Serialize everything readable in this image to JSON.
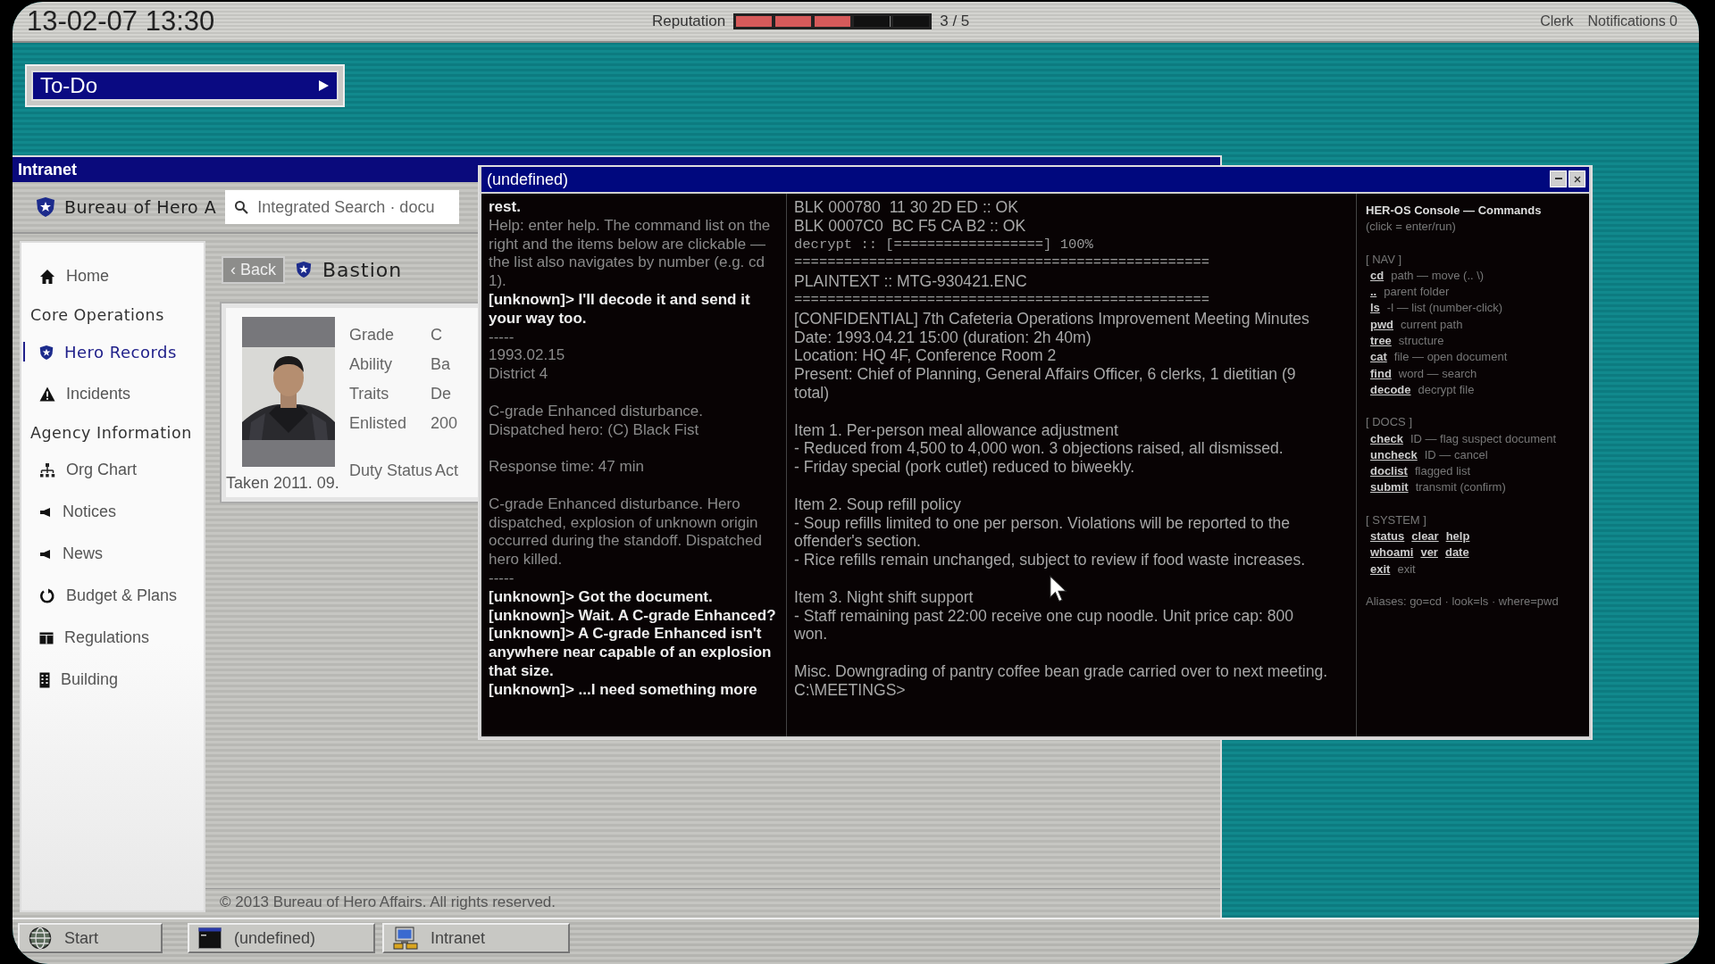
{
  "top_bar": {
    "date_time": "13-02-07 13:30",
    "reputation": {
      "label": "Reputation",
      "level": 0.6,
      "reading": "3 / 5"
    },
    "role": "Clerk",
    "notifications": "Notifications 0"
  },
  "todo": {
    "label": "To-Do"
  },
  "intranet": {
    "title": "Intranet",
    "org_name": "Bureau of Hero A",
    "search": {
      "placeholder": "Integrated Search · docu"
    },
    "sidebar": {
      "items": [
        {
          "kind": "link",
          "label": "Home",
          "selected": false
        },
        {
          "kind": "header",
          "label": "Core Operations"
        },
        {
          "kind": "link",
          "label": "Hero Records",
          "selected": true
        },
        {
          "kind": "link",
          "label": "Incidents",
          "selected": false
        },
        {
          "kind": "header",
          "label": "Agency Information"
        },
        {
          "kind": "link",
          "label": "Org Chart",
          "selected": false
        },
        {
          "kind": "link",
          "label": "Notices",
          "selected": false
        },
        {
          "kind": "link",
          "label": "News",
          "selected": false
        },
        {
          "kind": "link",
          "label": "Budget & Plans",
          "selected": false
        },
        {
          "kind": "link",
          "label": "Regulations",
          "selected": false
        },
        {
          "kind": "link",
          "label": "Building",
          "selected": false
        }
      ]
    },
    "back": "‹ Back",
    "record_title": "Bastion",
    "photo_caption": "Taken 2011. 09.",
    "fields": [
      {
        "label": "Grade",
        "value": "C"
      },
      {
        "label": "Ability",
        "value": "Ba"
      },
      {
        "label": "Traits",
        "value": "De"
      },
      {
        "label": "Enlisted",
        "value": "200"
      },
      {
        "label": "Duty Status",
        "value": "Act"
      }
    ],
    "footer": "© 2013 Bureau of Hero Affairs. All rights reserved."
  },
  "console": {
    "title": "(undefined)",
    "log": [
      {
        "kind": "bright",
        "text": "rest."
      },
      {
        "kind": "dim",
        "text": "Help: enter help. The command list on the right and the items below are clickable — the list also navigates by number (e.g. cd 1)."
      },
      {
        "kind": "bright",
        "text": "[unknown]> I'll decode it and send it your way too."
      },
      {
        "kind": "dim",
        "text": "-----"
      },
      {
        "kind": "dim",
        "text": "1993.02.15"
      },
      {
        "kind": "dim",
        "text": "District 4"
      },
      {
        "kind": "gap"
      },
      {
        "kind": "dim",
        "text": "C-grade Enhanced disturbance."
      },
      {
        "kind": "dim",
        "text": "Dispatched hero: (C) Black Fist"
      },
      {
        "kind": "gap"
      },
      {
        "kind": "dim",
        "text": "Response time: 47 min"
      },
      {
        "kind": "gap"
      },
      {
        "kind": "dim",
        "text": "C-grade Enhanced disturbance. Hero dispatched, explosion of unknown origin occurred during the standoff. Dispatched hero killed."
      },
      {
        "kind": "dim",
        "text": "-----"
      },
      {
        "kind": "bright",
        "text": "[unknown]> Got the document."
      },
      {
        "kind": "bright",
        "text": "[unknown]> Wait. A C-grade Enhanced?"
      },
      {
        "kind": "bright",
        "text": "[unknown]> A C-grade Enhanced isn't anywhere near capable of an explosion that size."
      },
      {
        "kind": "bright",
        "text": "[unknown]> ...I need something more"
      }
    ],
    "document": [
      {
        "kind": "text",
        "text": "BLK 000780  11 30 2D ED :: OK"
      },
      {
        "kind": "text",
        "text": "BLK 0007C0  BC F5 CA B2 :: OK"
      },
      {
        "kind": "mono",
        "text": "decrypt :: [==================] 100%"
      },
      {
        "kind": "mono",
        "text": "=================================================="
      },
      {
        "kind": "text",
        "text": "PLAINTEXT :: MTG-930421.ENC"
      },
      {
        "kind": "mono",
        "text": "=================================================="
      },
      {
        "kind": "text",
        "text": "[CONFIDENTIAL] 7th Cafeteria Operations Improvement Meeting Minutes"
      },
      {
        "kind": "text",
        "text": "Date: 1993.04.21 15:00 (duration: 2h 40m)"
      },
      {
        "kind": "text",
        "text": "Location: HQ 4F, Conference Room 2"
      },
      {
        "kind": "text",
        "text": "Present: Chief of Planning, General Affairs Officer, 6 clerks, 1 dietitian (9 total)"
      },
      {
        "kind": "gap"
      },
      {
        "kind": "text",
        "text": "Item 1. Per-person meal allowance adjustment"
      },
      {
        "kind": "text",
        "text": "- Reduced from 4,500 to 4,000 won. 3 objections raised, all dismissed."
      },
      {
        "kind": "text",
        "text": "- Friday special (pork cutlet) reduced to biweekly."
      },
      {
        "kind": "gap"
      },
      {
        "kind": "text",
        "text": "Item 2. Soup refill policy"
      },
      {
        "kind": "text",
        "text": "- Soup refills limited to one per person. Violations will be reported to the offender's section."
      },
      {
        "kind": "text",
        "text": "- Rice refills remain unchanged, subject to review if food waste increases."
      },
      {
        "kind": "gap"
      },
      {
        "kind": "text",
        "text": "Item 3. Night shift support"
      },
      {
        "kind": "text",
        "text": "- Staff remaining past 22:00 receive one cup noodle. Unit price cap: 800 won."
      },
      {
        "kind": "gap"
      },
      {
        "kind": "text",
        "text": "Misc. Downgrading of pantry coffee bean grade carried over to next meeting."
      },
      {
        "kind": "text",
        "text": "C:\\MEETINGS>"
      }
    ],
    "commands": {
      "title": "HER-OS Console — Commands",
      "hint": "(click = enter/run)",
      "sections": [
        {
          "heading": "[ NAV ]",
          "rows": [
            {
              "commands": [
                "cd"
              ],
              "desc": "path — move (.. \\)"
            },
            {
              "commands": [
                ".."
              ],
              "desc": "parent folder"
            },
            {
              "commands": [
                "ls"
              ],
              "desc": "-l — list (number-click)"
            },
            {
              "commands": [
                "pwd"
              ],
              "desc": "current path"
            },
            {
              "commands": [
                "tree"
              ],
              "desc": "structure"
            },
            {
              "commands": [
                "cat"
              ],
              "desc": "file — open document"
            },
            {
              "commands": [
                "find"
              ],
              "desc": "word — search"
            },
            {
              "commands": [
                "decode"
              ],
              "desc": "decrypt file"
            }
          ]
        },
        {
          "heading": "[ DOCS ]",
          "rows": [
            {
              "commands": [
                "check"
              ],
              "desc": "ID — flag suspect document"
            },
            {
              "commands": [
                "uncheck"
              ],
              "desc": "ID — cancel"
            },
            {
              "commands": [
                "doclist"
              ],
              "desc": "flagged list"
            },
            {
              "commands": [
                "submit"
              ],
              "desc": "transmit (confirm)"
            }
          ]
        },
        {
          "heading": "[ SYSTEM ]",
          "rows": [
            {
              "commands": [
                "status",
                "clear",
                "help"
              ]
            },
            {
              "commands": [
                "whoami",
                "ver",
                "date"
              ]
            },
            {
              "commands": [
                "exit"
              ],
              "desc": "exit"
            }
          ]
        }
      ],
      "aliases": "Aliases: go=cd · look=ls · where=pwd"
    }
  },
  "taskbar": [
    {
      "kind": "start",
      "label": "Start"
    },
    {
      "kind": "console",
      "label": "(undefined)"
    },
    {
      "kind": "intranet",
      "label": "Intranet"
    }
  ]
}
